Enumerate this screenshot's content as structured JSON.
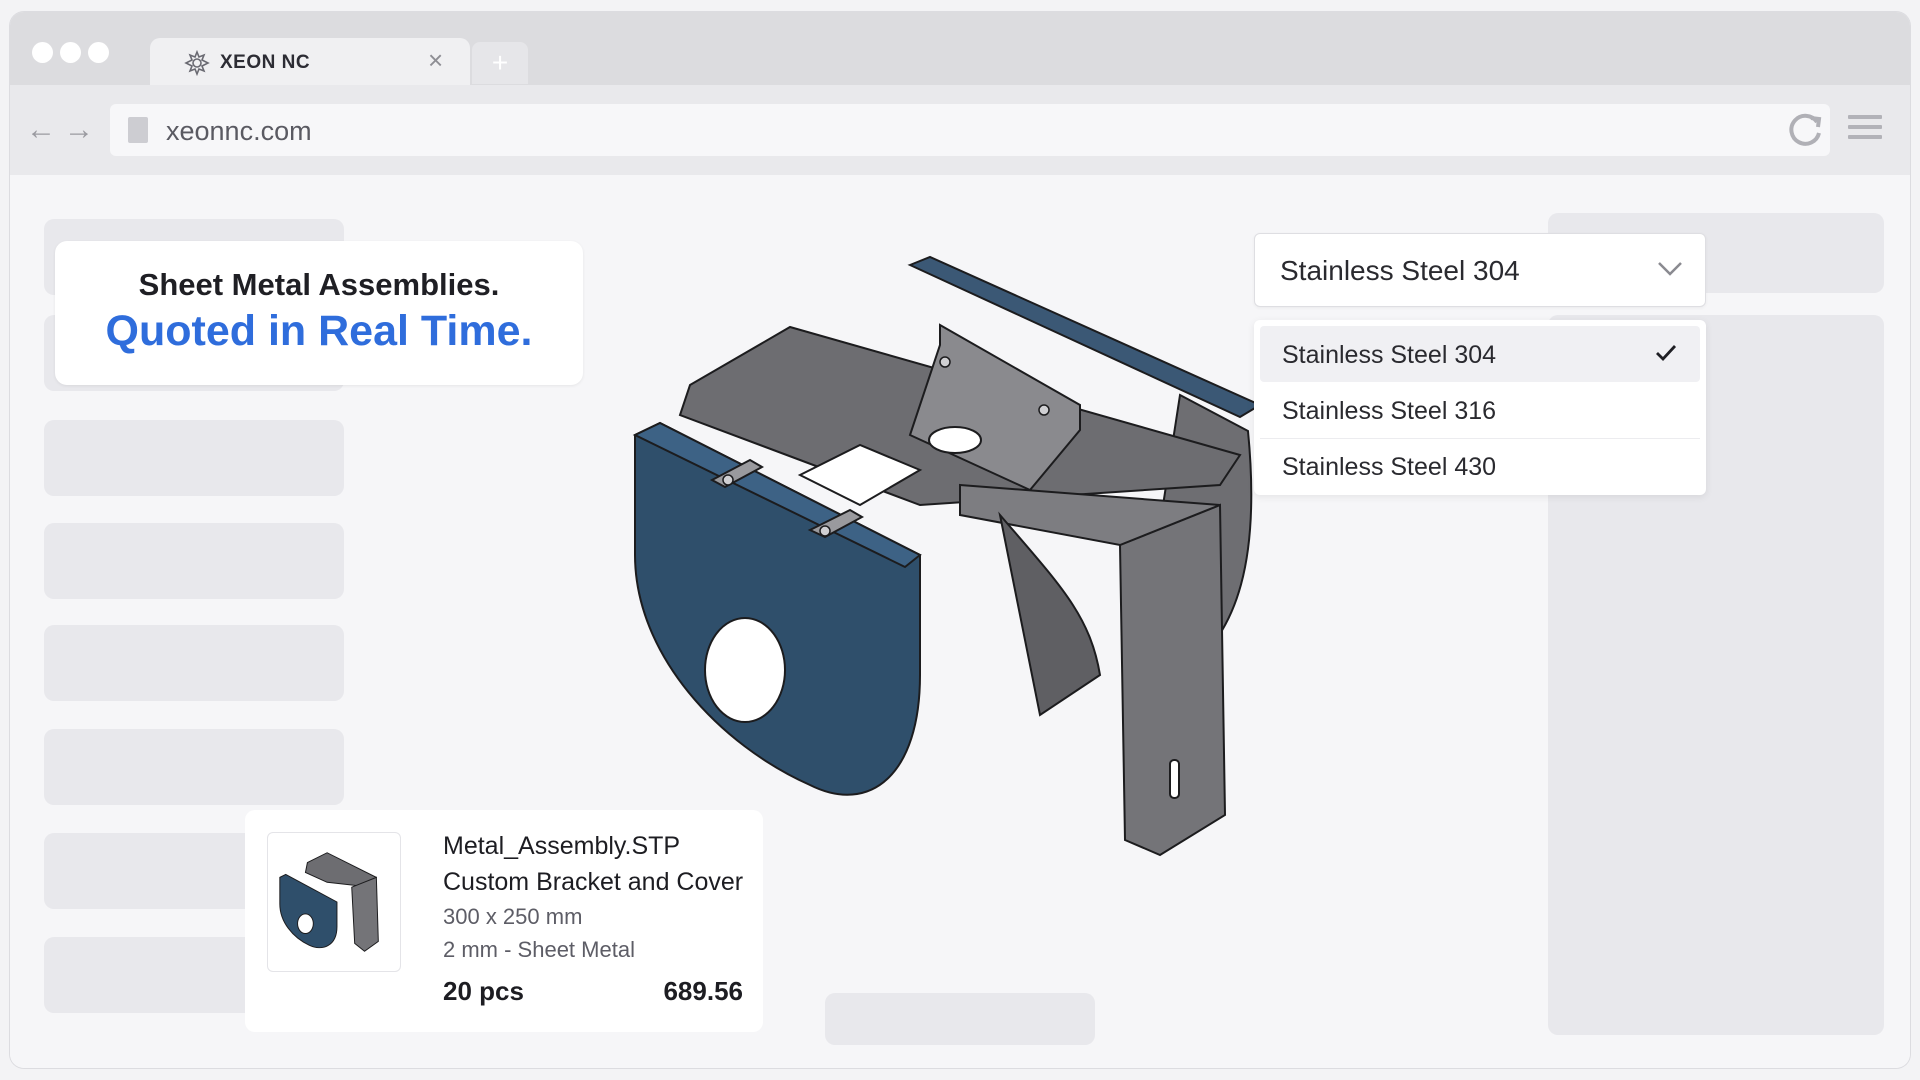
{
  "browser": {
    "tab_title": "XEON NC",
    "tab_close": "×",
    "new_tab": "+",
    "url": "xeonnc.com",
    "icons": [
      "back-arrow-icon",
      "forward-arrow-icon",
      "document-icon",
      "reload-icon",
      "hamburger-menu-icon",
      "xeon-logo-icon"
    ]
  },
  "hero": {
    "line1": "Sheet Metal Assemblies.",
    "line2": "Quoted in Real Time.",
    "accent_color": "#2f6ddc"
  },
  "material_select": {
    "selected": "Stainless Steel 304",
    "options": [
      {
        "label": "Stainless Steel 304",
        "selected": true
      },
      {
        "label": "Stainless Steel 316",
        "selected": false
      },
      {
        "label": "Stainless Steel 430",
        "selected": false
      }
    ]
  },
  "part": {
    "file_name": "Metal_Assembly.STP",
    "description": "Custom Bracket and Cover",
    "dimensions": "300 x 250 mm",
    "material": "2 mm - Sheet Metal",
    "quantity": "20 pcs",
    "price": "689.56",
    "colors": {
      "cover": "#2f4f6b",
      "bracket": "#6b6b6e"
    }
  }
}
